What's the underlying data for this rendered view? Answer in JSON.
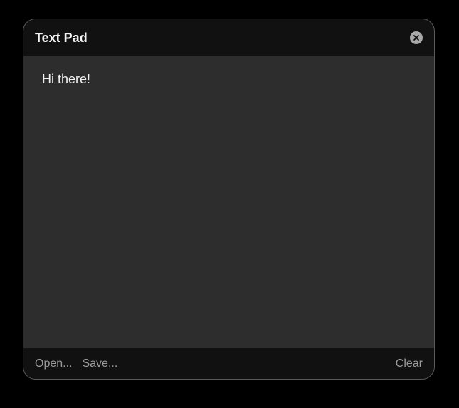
{
  "window": {
    "title": "Text Pad"
  },
  "editor": {
    "content": "Hi there!"
  },
  "footer": {
    "open_label": "Open...",
    "save_label": "Save...",
    "clear_label": "Clear"
  },
  "icons": {
    "close": "close-icon"
  },
  "colors": {
    "background": "#000000",
    "titlebar": "#111111",
    "editor_bg": "#2d2d2d",
    "text": "#f0f0f0",
    "muted_text": "#9b9b9b"
  }
}
